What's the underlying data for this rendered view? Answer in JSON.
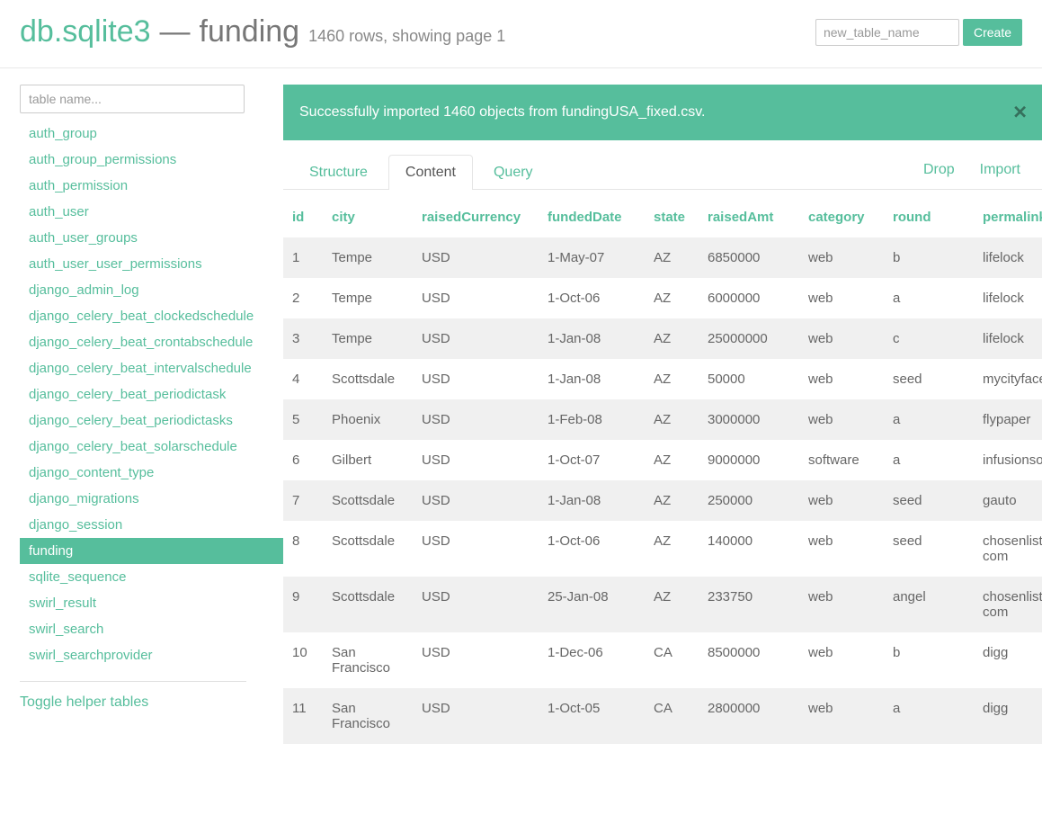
{
  "header": {
    "db_name": "db.sqlite3",
    "dash": "—",
    "table_name": "funding",
    "row_info": "1460 rows, showing page 1",
    "new_table_placeholder": "new_table_name",
    "create_label": "Create"
  },
  "alert": {
    "message": "Successfully imported 1460 objects from fundingUSA_fixed.csv.",
    "close": "✕"
  },
  "sidebar": {
    "filter_placeholder": "table name...",
    "active": "funding",
    "tables": [
      "auth_group",
      "auth_group_permissions",
      "auth_permission",
      "auth_user",
      "auth_user_groups",
      "auth_user_user_permissions",
      "django_admin_log",
      "django_celery_beat_clockedschedule",
      "django_celery_beat_crontabschedule",
      "django_celery_beat_intervalschedule",
      "django_celery_beat_periodictask",
      "django_celery_beat_periodictasks",
      "django_celery_beat_solarschedule",
      "django_content_type",
      "django_migrations",
      "django_session",
      "funding",
      "sqlite_sequence",
      "swirl_result",
      "swirl_search",
      "swirl_searchprovider"
    ],
    "toggle_label": "Toggle helper tables"
  },
  "tabs": {
    "items": [
      {
        "label": "Structure",
        "active": false
      },
      {
        "label": "Content",
        "active": true
      },
      {
        "label": "Query",
        "active": false
      }
    ],
    "drop_label": "Drop",
    "import_label": "Import"
  },
  "table": {
    "columns": [
      "id",
      "city",
      "raisedCurrency",
      "fundedDate",
      "state",
      "raisedAmt",
      "category",
      "round",
      "permalink"
    ],
    "rows": [
      {
        "id": "1",
        "city": "Tempe",
        "raisedCurrency": "USD",
        "fundedDate": "1-May-07",
        "state": "AZ",
        "raisedAmt": "6850000",
        "category": "web",
        "round": "b",
        "permalink": "lifelock"
      },
      {
        "id": "2",
        "city": "Tempe",
        "raisedCurrency": "USD",
        "fundedDate": "1-Oct-06",
        "state": "AZ",
        "raisedAmt": "6000000",
        "category": "web",
        "round": "a",
        "permalink": "lifelock"
      },
      {
        "id": "3",
        "city": "Tempe",
        "raisedCurrency": "USD",
        "fundedDate": "1-Jan-08",
        "state": "AZ",
        "raisedAmt": "25000000",
        "category": "web",
        "round": "c",
        "permalink": "lifelock"
      },
      {
        "id": "4",
        "city": "Scottsdale",
        "raisedCurrency": "USD",
        "fundedDate": "1-Jan-08",
        "state": "AZ",
        "raisedAmt": "50000",
        "category": "web",
        "round": "seed",
        "permalink": "mycityfaces"
      },
      {
        "id": "5",
        "city": "Phoenix",
        "raisedCurrency": "USD",
        "fundedDate": "1-Feb-08",
        "state": "AZ",
        "raisedAmt": "3000000",
        "category": "web",
        "round": "a",
        "permalink": "flypaper"
      },
      {
        "id": "6",
        "city": "Gilbert",
        "raisedCurrency": "USD",
        "fundedDate": "1-Oct-07",
        "state": "AZ",
        "raisedAmt": "9000000",
        "category": "software",
        "round": "a",
        "permalink": "infusionsoft"
      },
      {
        "id": "7",
        "city": "Scottsdale",
        "raisedCurrency": "USD",
        "fundedDate": "1-Jan-08",
        "state": "AZ",
        "raisedAmt": "250000",
        "category": "web",
        "round": "seed",
        "permalink": "gauto"
      },
      {
        "id": "8",
        "city": "Scottsdale",
        "raisedCurrency": "USD",
        "fundedDate": "1-Oct-06",
        "state": "AZ",
        "raisedAmt": "140000",
        "category": "web",
        "round": "seed",
        "permalink": "chosenlist-com"
      },
      {
        "id": "9",
        "city": "Scottsdale",
        "raisedCurrency": "USD",
        "fundedDate": "25-Jan-08",
        "state": "AZ",
        "raisedAmt": "233750",
        "category": "web",
        "round": "angel",
        "permalink": "chosenlist-com"
      },
      {
        "id": "10",
        "city": "San Francisco",
        "raisedCurrency": "USD",
        "fundedDate": "1-Dec-06",
        "state": "CA",
        "raisedAmt": "8500000",
        "category": "web",
        "round": "b",
        "permalink": "digg"
      },
      {
        "id": "11",
        "city": "San Francisco",
        "raisedCurrency": "USD",
        "fundedDate": "1-Oct-05",
        "state": "CA",
        "raisedAmt": "2800000",
        "category": "web",
        "round": "a",
        "permalink": "digg"
      }
    ]
  }
}
